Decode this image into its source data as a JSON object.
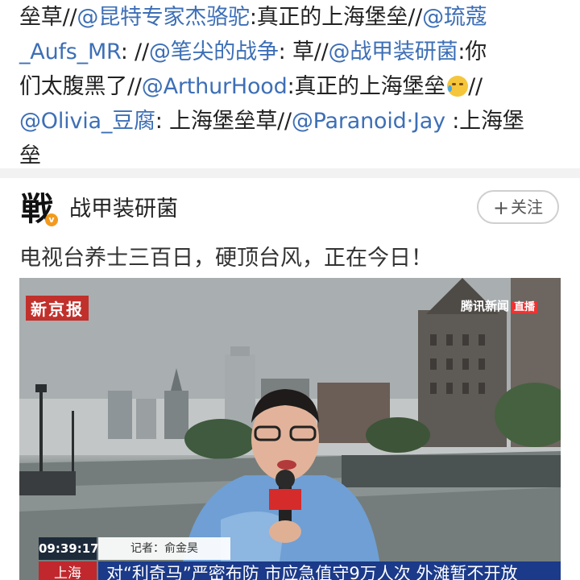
{
  "thread": {
    "line1": [
      {
        "t": "垒草//"
      },
      {
        "t": "@昆特专家杰骆驼",
        "m": true
      },
      {
        "t": ":真正的上海堡垒//"
      },
      {
        "t": "@琉蔻",
        "m": true
      }
    ],
    "line2": [
      {
        "t": "_Aufs_MR",
        "m": true
      },
      {
        "t": ": //"
      },
      {
        "t": "@笔尖的战争",
        "m": true
      },
      {
        "t": ": 草//"
      },
      {
        "t": "@战甲装研菌",
        "m": true
      },
      {
        "t": ":你"
      }
    ],
    "line3": [
      {
        "t": "们太腹黑了//"
      },
      {
        "t": "@ArthurHood",
        "m": true
      },
      {
        "t": ":真正的上海堡垒"
      }
    ],
    "line3_tail": "//",
    "line4": [
      {
        "t": "@Olivia_豆腐",
        "m": true
      },
      {
        "t": ": 上海堡垒草//"
      },
      {
        "t": "@Paranoid·Jay",
        "m": true
      },
      {
        "t": " :上海堡"
      }
    ],
    "line5": [
      {
        "t": "垒"
      }
    ]
  },
  "card": {
    "avatar_glyph": "戦",
    "verified_badge": "v",
    "author_name": "战甲装研菌",
    "follow_label": "关注",
    "follow_plus": "+",
    "post_text": "电视台养士三百日，硬顶台风，正在今日！"
  },
  "video": {
    "source_logo": "新京报",
    "news_logo": "腾讯新闻",
    "live_tag": "直播",
    "timecode": "09:39:17",
    "reporter_label": "记者：俞金昊",
    "location": "上海",
    "headline": "对“利奇马”严密布防 市应急值守9万人次 外滩暂不开放",
    "mic_flag": "新京报"
  },
  "colors": {
    "mention": "#3d6fb6",
    "text": "#222222",
    "separator": "#f2f2f2",
    "brand_red": "#c1302b"
  }
}
